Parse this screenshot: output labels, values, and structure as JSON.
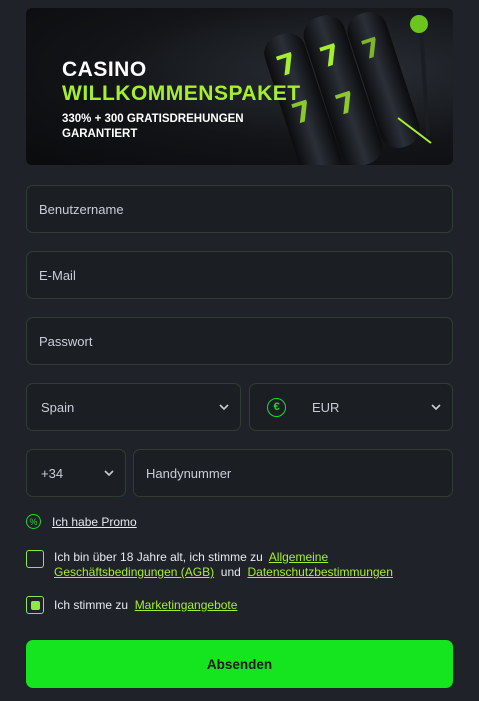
{
  "banner": {
    "title_1": "CASINO",
    "title_2": "WILLKOMMENSPAKET",
    "subtitle": "330% + 300 GRATISDREHUNGEN GARANTIERT"
  },
  "form": {
    "username_placeholder": "Benutzername",
    "email_placeholder": "E-Mail",
    "password_placeholder": "Passwort",
    "country_value": "Spain",
    "currency_value": "EUR",
    "currency_symbol": "€",
    "phone_code_value": "+34",
    "phone_placeholder": "Handynummer"
  },
  "promo": {
    "label": "Ich habe Promo",
    "icon": "percent-badge-icon"
  },
  "terms": {
    "text_before": "Ich bin über 18 Jahre alt, ich stimme zu",
    "link_1": "Allgemeine Geschäftsbedingungen (AGB)",
    "connector": "und",
    "link_2": "Datenschutzbestimmungen",
    "checked": false
  },
  "marketing": {
    "text_before": "Ich stimme zu",
    "link": "Marketingangebote",
    "checked": true
  },
  "submit_label": "Absenden",
  "colors": {
    "background": "#1f2329",
    "accent": "#14e51e",
    "link": "#a6ef2e",
    "field_border": "#2f3e31"
  }
}
